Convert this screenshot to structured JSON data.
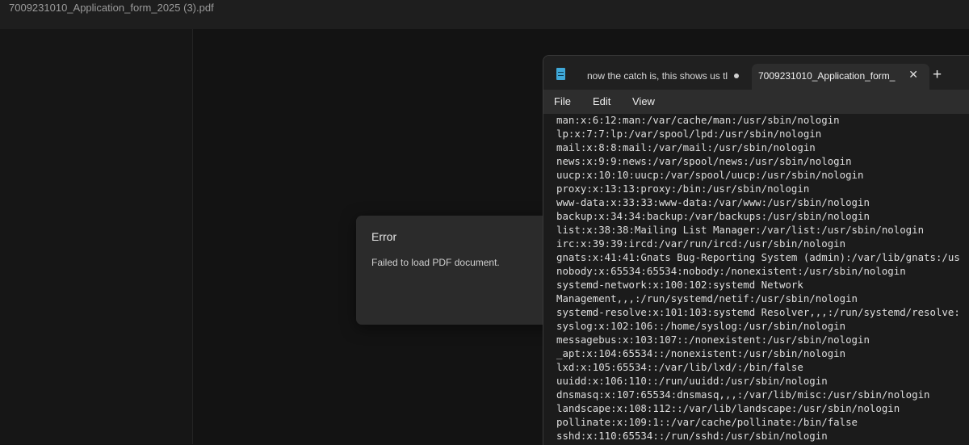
{
  "pdf_viewer": {
    "title": "7009231010_Application_form_2025 (3).pdf"
  },
  "error_dialog": {
    "title": "Error",
    "message": "Failed to load PDF document."
  },
  "notepad": {
    "tabs": [
      {
        "label": "now the catch is, this shows us tl",
        "unsaved": true
      },
      {
        "label": "7009231010_Application_form_",
        "active": true
      }
    ],
    "menu": [
      "File",
      "Edit",
      "View"
    ],
    "lines": [
      "man:x:6:12:man:/var/cache/man:/usr/sbin/nologin",
      "lp:x:7:7:lp:/var/spool/lpd:/usr/sbin/nologin",
      "mail:x:8:8:mail:/var/mail:/usr/sbin/nologin",
      "news:x:9:9:news:/var/spool/news:/usr/sbin/nologin",
      "uucp:x:10:10:uucp:/var/spool/uucp:/usr/sbin/nologin",
      "proxy:x:13:13:proxy:/bin:/usr/sbin/nologin",
      "www-data:x:33:33:www-data:/var/www:/usr/sbin/nologin",
      "backup:x:34:34:backup:/var/backups:/usr/sbin/nologin",
      "list:x:38:38:Mailing List Manager:/var/list:/usr/sbin/nologin",
      "irc:x:39:39:ircd:/var/run/ircd:/usr/sbin/nologin",
      "gnats:x:41:41:Gnats Bug-Reporting System (admin):/var/lib/gnats:/us",
      "nobody:x:65534:65534:nobody:/nonexistent:/usr/sbin/nologin",
      "systemd-network:x:100:102:systemd Network",
      "Management,,,:/run/systemd/netif:/usr/sbin/nologin",
      "systemd-resolve:x:101:103:systemd Resolver,,,:/run/systemd/resolve:",
      "syslog:x:102:106::/home/syslog:/usr/sbin/nologin",
      "messagebus:x:103:107::/nonexistent:/usr/sbin/nologin",
      "_apt:x:104:65534::/nonexistent:/usr/sbin/nologin",
      "lxd:x:105:65534::/var/lib/lxd/:/bin/false",
      "uuidd:x:106:110::/run/uuidd:/usr/sbin/nologin",
      "dnsmasq:x:107:65534:dnsmasq,,,:/var/lib/misc:/usr/sbin/nologin",
      "landscape:x:108:112::/var/lib/landscape:/usr/sbin/nologin",
      "pollinate:x:109:1::/var/cache/pollinate:/bin/false",
      "sshd:x:110:65534::/run/sshd:/usr/sbin/nologin"
    ]
  }
}
